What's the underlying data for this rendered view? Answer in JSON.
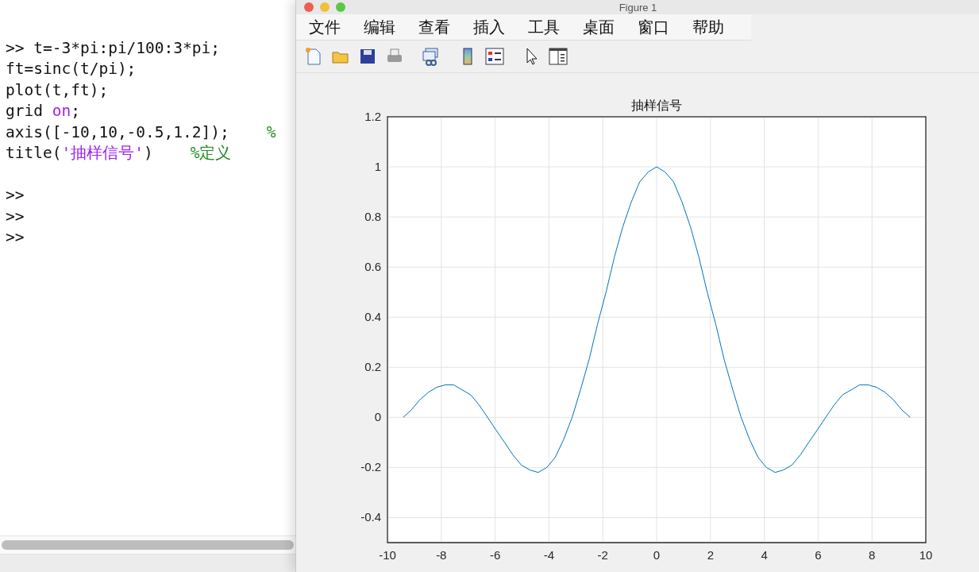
{
  "console": {
    "lines": [
      {
        "segments": [
          {
            "kind": "code",
            "text": ">> t=-3*pi:pi/100:3*pi;"
          }
        ]
      },
      {
        "segments": [
          {
            "kind": "code",
            "text": "ft=sinc(t/pi);"
          }
        ]
      },
      {
        "segments": [
          {
            "kind": "code",
            "text": "plot(t,ft);"
          }
        ]
      },
      {
        "segments": [
          {
            "kind": "code",
            "text": "grid "
          },
          {
            "kind": "keyword",
            "text": "on"
          },
          {
            "kind": "code",
            "text": ";"
          }
        ]
      },
      {
        "segments": [
          {
            "kind": "code",
            "text": "axis([-10,10,-0.5,1.2]);"
          },
          {
            "kind": "comment",
            "text": "%"
          }
        ]
      },
      {
        "segments": [
          {
            "kind": "code",
            "text": "title("
          },
          {
            "kind": "string",
            "text": "'抽样信号'"
          },
          {
            "kind": "code",
            "text": ")"
          },
          {
            "kind": "comment",
            "text": "%定义"
          }
        ]
      }
    ],
    "prompts": [
      ">>",
      ">>",
      ">>"
    ]
  },
  "figure": {
    "title": "Figure 1",
    "menu": [
      "文件",
      "编辑",
      "查看",
      "插入",
      "工具",
      "桌面",
      "窗口",
      "帮助"
    ],
    "toolbar": [
      {
        "kind": "new"
      },
      {
        "kind": "open"
      },
      {
        "kind": "save"
      },
      {
        "kind": "print"
      },
      {
        "kind": "link"
      },
      {
        "kind": "colorbar"
      },
      {
        "kind": "legend"
      },
      {
        "kind": "pointer"
      },
      {
        "kind": "panel"
      }
    ],
    "chart_data": {
      "type": "line",
      "title": "抽样信号",
      "grid": true,
      "xlim": [
        -10,
        10
      ],
      "ylim": [
        -0.5,
        1.2
      ],
      "xticks": [
        -10,
        -8,
        -6,
        -4,
        -2,
        0,
        2,
        4,
        6,
        8,
        10
      ],
      "yticks": [
        -0.4,
        -0.2,
        0,
        0.2,
        0.4,
        0.6,
        0.8,
        1,
        1.2
      ],
      "x": [
        -9.42,
        -9.11,
        -8.8,
        -8.48,
        -8.17,
        -7.85,
        -7.54,
        -7.23,
        -6.91,
        -6.6,
        -6.28,
        -5.97,
        -5.65,
        -5.34,
        -5.03,
        -4.71,
        -4.4,
        -4.08,
        -3.77,
        -3.46,
        -3.14,
        -2.83,
        -2.51,
        -2.2,
        -1.88,
        -1.57,
        -1.26,
        -0.94,
        -0.63,
        -0.31,
        0,
        0.31,
        0.63,
        0.94,
        1.26,
        1.57,
        1.88,
        2.2,
        2.51,
        2.83,
        3.14,
        3.46,
        3.77,
        4.08,
        4.4,
        4.71,
        5.03,
        5.34,
        5.65,
        5.97,
        6.28,
        6.6,
        6.91,
        7.23,
        7.54,
        7.85,
        8.17,
        8.48,
        8.8,
        9.11,
        9.42
      ],
      "series": [
        {
          "color": "#0072bd",
          "values": [
            0,
            0.03,
            0.07,
            0.1,
            0.12,
            0.13,
            0.13,
            0.11,
            0.09,
            0.05,
            0,
            -0.05,
            -0.1,
            -0.15,
            -0.19,
            -0.21,
            -0.22,
            -0.2,
            -0.16,
            -0.09,
            0,
            0.11,
            0.23,
            0.37,
            0.5,
            0.64,
            0.76,
            0.86,
            0.94,
            0.98,
            1,
            0.98,
            0.94,
            0.86,
            0.76,
            0.64,
            0.5,
            0.37,
            0.23,
            0.11,
            0,
            -0.09,
            -0.16,
            -0.2,
            -0.22,
            -0.21,
            -0.19,
            -0.15,
            -0.1,
            -0.05,
            0,
            0.05,
            0.09,
            0.11,
            0.13,
            0.13,
            0.12,
            0.1,
            0.07,
            0.03,
            0
          ]
        }
      ]
    }
  }
}
